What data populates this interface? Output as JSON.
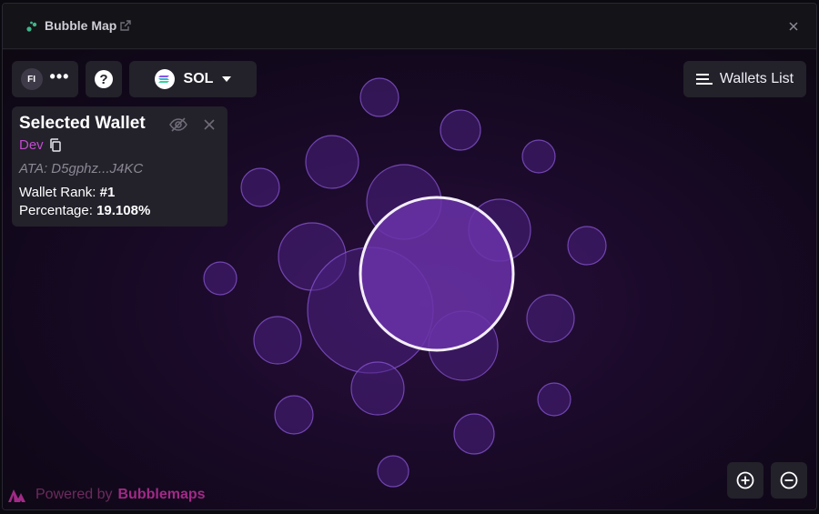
{
  "window": {
    "title": "Bubble Map"
  },
  "toolbar": {
    "avatar_initials": "FI",
    "more_label": "•••",
    "help_label": "?",
    "chain_label": "SOL",
    "wallets_list_label": "Wallets List"
  },
  "selected_wallet": {
    "title": "Selected Wallet",
    "name": "Dev",
    "ata_label": "ATA:",
    "ata_value": "D5gphz...J4KC",
    "rank_label": "Wallet Rank:",
    "rank_value": "#1",
    "percentage_label": "Percentage:",
    "percentage_value": "19.108%"
  },
  "footer": {
    "powered_by": "Powered by",
    "brand": "Bubblemaps"
  },
  "colors": {
    "accent": "#c24bd0",
    "bubble_fill": "#5a2a90",
    "bubble_stroke": "#8a57d6",
    "selected_fill": "#6a33a8",
    "brand": "#a12a86"
  },
  "icons": {
    "title_logo": "bubble-logo-icon",
    "external": "external-link-icon",
    "close": "close-icon",
    "hide": "eye-off-icon",
    "copy": "copy-icon",
    "list": "list-icon",
    "dropdown": "caret-down-icon",
    "zoom_in": "zoom-in-icon",
    "zoom_out": "zoom-out-icon"
  }
}
